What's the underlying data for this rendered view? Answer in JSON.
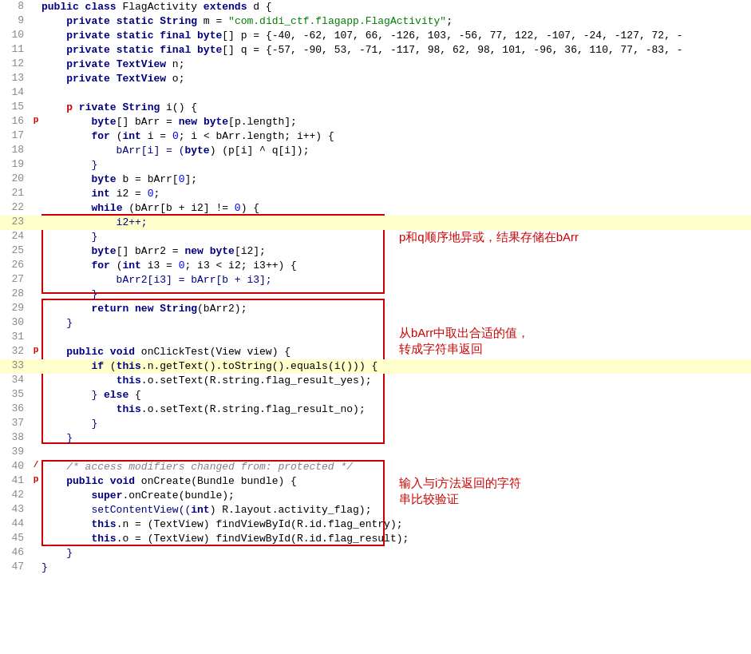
{
  "lines": [
    {
      "num": "8",
      "marker": "",
      "highlight": false,
      "tokens": [
        {
          "t": "public ",
          "c": "kw"
        },
        {
          "t": "class ",
          "c": "kw"
        },
        {
          "t": "FlagActivity ",
          "c": "plain"
        },
        {
          "t": "extends ",
          "c": "kw"
        },
        {
          "t": "d {",
          "c": "plain"
        }
      ]
    },
    {
      "num": "9",
      "marker": "",
      "highlight": false,
      "tokens": [
        {
          "t": "    "
        },
        {
          "t": "private ",
          "c": "kw"
        },
        {
          "t": "static ",
          "c": "kw"
        },
        {
          "t": "String ",
          "c": "type"
        },
        {
          "t": "m = ",
          "c": "plain"
        },
        {
          "t": "\"com.didi_ctf.flagapp.FlagActivity\"",
          "c": "str"
        },
        {
          "t": ";",
          "c": "plain"
        }
      ]
    },
    {
      "num": "10",
      "marker": "",
      "highlight": false,
      "tokens": [
        {
          "t": "    "
        },
        {
          "t": "private ",
          "c": "kw"
        },
        {
          "t": "static ",
          "c": "kw"
        },
        {
          "t": "final ",
          "c": "kw"
        },
        {
          "t": "byte",
          "c": "type"
        },
        {
          "t": "[] p = {-40, -62, 107, 66, -126, 103, -56, 77, 122, -107, -24, -127, 72, -",
          "c": "plain"
        }
      ]
    },
    {
      "num": "11",
      "marker": "",
      "highlight": false,
      "tokens": [
        {
          "t": "    "
        },
        {
          "t": "private ",
          "c": "kw"
        },
        {
          "t": "static ",
          "c": "kw"
        },
        {
          "t": "final ",
          "c": "kw"
        },
        {
          "t": "byte",
          "c": "type"
        },
        {
          "t": "[] q = {-57, -90, 53, -71, -117, 98, 62, 98, 101, -96, 36, 110, 77, -83, -",
          "c": "plain"
        }
      ]
    },
    {
      "num": "12",
      "marker": "",
      "highlight": false,
      "tokens": [
        {
          "t": "    "
        },
        {
          "t": "private ",
          "c": "kw"
        },
        {
          "t": "TextView ",
          "c": "type"
        },
        {
          "t": "n;",
          "c": "plain"
        }
      ]
    },
    {
      "num": "13",
      "marker": "",
      "highlight": false,
      "tokens": [
        {
          "t": "    "
        },
        {
          "t": "private ",
          "c": "kw"
        },
        {
          "t": "TextView ",
          "c": "type"
        },
        {
          "t": "o;",
          "c": "plain"
        }
      ]
    },
    {
      "num": "14",
      "marker": "",
      "highlight": false,
      "tokens": [
        {
          "t": ""
        }
      ]
    },
    {
      "num": "15",
      "marker": "",
      "highlight": false,
      "tokens": [
        {
          "t": "    "
        },
        {
          "t": "p",
          "c": "kw2"
        },
        {
          "t": " ",
          "c": "plain"
        },
        {
          "t": "rivate String ",
          "c": "kw"
        },
        {
          "t": "i() {",
          "c": "plain"
        }
      ]
    },
    {
      "num": "16",
      "marker": "p",
      "highlight": false,
      "tokens": [
        {
          "t": "        "
        },
        {
          "t": "byte",
          "c": "type"
        },
        {
          "t": "[] bArr = ",
          "c": "plain"
        },
        {
          "t": "new ",
          "c": "kw"
        },
        {
          "t": "byte",
          "c": "type"
        },
        {
          "t": "[p.length];",
          "c": "plain"
        }
      ]
    },
    {
      "num": "17",
      "marker": "",
      "highlight": false,
      "tokens": [
        {
          "t": "        "
        },
        {
          "t": "for ",
          "c": "kw"
        },
        {
          "t": "(",
          "c": "plain"
        },
        {
          "t": "int ",
          "c": "type"
        },
        {
          "t": "i = ",
          "c": "plain"
        },
        {
          "t": "0",
          "c": "num"
        },
        {
          "t": "; i < bArr.length; i++) {",
          "c": "plain"
        }
      ]
    },
    {
      "num": "18",
      "marker": "",
      "highlight": false,
      "tokens": [
        {
          "t": "            bArr[i] = ("
        },
        {
          "t": "byte",
          "c": "type"
        },
        {
          "t": ") (p[i] ^ q[i]);",
          "c": "plain"
        }
      ]
    },
    {
      "num": "19",
      "marker": "",
      "highlight": false,
      "tokens": [
        {
          "t": "        }"
        }
      ]
    },
    {
      "num": "20",
      "marker": "",
      "highlight": false,
      "tokens": [
        {
          "t": "        "
        },
        {
          "t": "byte",
          "c": "type"
        },
        {
          "t": " b = bArr[",
          "c": "plain"
        },
        {
          "t": "0",
          "c": "num"
        },
        {
          "t": "];",
          "c": "plain"
        }
      ]
    },
    {
      "num": "21",
      "marker": "",
      "highlight": false,
      "tokens": [
        {
          "t": "        "
        },
        {
          "t": "int ",
          "c": "type"
        },
        {
          "t": "i2 = ",
          "c": "plain"
        },
        {
          "t": "0",
          "c": "num"
        },
        {
          "t": ";",
          "c": "plain"
        }
      ]
    },
    {
      "num": "22",
      "marker": "",
      "highlight": false,
      "tokens": [
        {
          "t": "        "
        },
        {
          "t": "while ",
          "c": "kw"
        },
        {
          "t": "(bArr[b + i2] != ",
          "c": "plain"
        },
        {
          "t": "0",
          "c": "num"
        },
        {
          "t": ") {",
          "c": "plain"
        }
      ]
    },
    {
      "num": "23",
      "marker": "",
      "highlight": true,
      "tokens": [
        {
          "t": "            i2++;"
        }
      ]
    },
    {
      "num": "24",
      "marker": "",
      "highlight": false,
      "tokens": [
        {
          "t": "        }"
        }
      ]
    },
    {
      "num": "25",
      "marker": "",
      "highlight": false,
      "tokens": [
        {
          "t": "        "
        },
        {
          "t": "byte",
          "c": "type"
        },
        {
          "t": "[] bArr2 = ",
          "c": "plain"
        },
        {
          "t": "new ",
          "c": "kw"
        },
        {
          "t": "byte",
          "c": "type"
        },
        {
          "t": "[i2];",
          "c": "plain"
        }
      ]
    },
    {
      "num": "26",
      "marker": "",
      "highlight": false,
      "tokens": [
        {
          "t": "        "
        },
        {
          "t": "for ",
          "c": "kw"
        },
        {
          "t": "(",
          "c": "plain"
        },
        {
          "t": "int ",
          "c": "type"
        },
        {
          "t": "i3 = ",
          "c": "plain"
        },
        {
          "t": "0",
          "c": "num"
        },
        {
          "t": "; i3 < i2; i3++) {",
          "c": "plain"
        }
      ]
    },
    {
      "num": "27",
      "marker": "",
      "highlight": false,
      "tokens": [
        {
          "t": "            bArr2[i3] = bArr[b + i3];"
        }
      ]
    },
    {
      "num": "28",
      "marker": "",
      "highlight": false,
      "tokens": [
        {
          "t": "        }"
        }
      ]
    },
    {
      "num": "29",
      "marker": "",
      "highlight": false,
      "tokens": [
        {
          "t": "        "
        },
        {
          "t": "return ",
          "c": "kw"
        },
        {
          "t": "new ",
          "c": "kw"
        },
        {
          "t": "String",
          "c": "type"
        },
        {
          "t": "(bArr2);",
          "c": "plain"
        }
      ]
    },
    {
      "num": "30",
      "marker": "",
      "highlight": false,
      "tokens": [
        {
          "t": "    }"
        }
      ]
    },
    {
      "num": "31",
      "marker": "",
      "highlight": false,
      "tokens": [
        {
          "t": ""
        }
      ]
    },
    {
      "num": "32",
      "marker": "p",
      "highlight": false,
      "tokens": [
        {
          "t": "    "
        },
        {
          "t": "public ",
          "c": "kw"
        },
        {
          "t": "void ",
          "c": "type"
        },
        {
          "t": "onClickTest(View view) {",
          "c": "plain"
        }
      ]
    },
    {
      "num": "33",
      "marker": "",
      "highlight": true,
      "tokens": [
        {
          "t": "        "
        },
        {
          "t": "if ",
          "c": "kw"
        },
        {
          "t": "(",
          "c": "plain"
        },
        {
          "t": "this",
          "c": "kw"
        },
        {
          "t": ".n.getText().toString().equals(i())) {",
          "c": "plain"
        }
      ]
    },
    {
      "num": "34",
      "marker": "",
      "highlight": false,
      "tokens": [
        {
          "t": "            "
        },
        {
          "t": "this",
          "c": "kw"
        },
        {
          "t": ".o.setText(R.string.flag_result_yes);",
          "c": "plain"
        }
      ]
    },
    {
      "num": "35",
      "marker": "",
      "highlight": false,
      "tokens": [
        {
          "t": "        } "
        },
        {
          "t": "else ",
          "c": "kw"
        },
        {
          "t": "{",
          "c": "plain"
        }
      ]
    },
    {
      "num": "36",
      "marker": "",
      "highlight": false,
      "tokens": [
        {
          "t": "            "
        },
        {
          "t": "this",
          "c": "kw"
        },
        {
          "t": ".o.setText(R.string.flag_result_no);",
          "c": "plain"
        }
      ]
    },
    {
      "num": "37",
      "marker": "",
      "highlight": false,
      "tokens": [
        {
          "t": "        }"
        }
      ]
    },
    {
      "num": "38",
      "marker": "",
      "highlight": false,
      "tokens": [
        {
          "t": "    }"
        }
      ]
    },
    {
      "num": "39",
      "marker": "",
      "highlight": false,
      "tokens": [
        {
          "t": ""
        }
      ]
    },
    {
      "num": "40",
      "marker": "/",
      "highlight": false,
      "tokens": [
        {
          "t": "    "
        },
        {
          "t": "/* access modifiers changed from: protected */",
          "c": "comment"
        }
      ]
    },
    {
      "num": "41",
      "marker": "p",
      "highlight": false,
      "tokens": [
        {
          "t": "    "
        },
        {
          "t": "public ",
          "c": "kw"
        },
        {
          "t": "void ",
          "c": "type"
        },
        {
          "t": "onCreate(Bundle bundle) {",
          "c": "plain"
        }
      ]
    },
    {
      "num": "42",
      "marker": "",
      "highlight": false,
      "tokens": [
        {
          "t": "        "
        },
        {
          "t": "super",
          "c": "kw"
        },
        {
          "t": ".onCreate(bundle);",
          "c": "plain"
        }
      ]
    },
    {
      "num": "43",
      "marker": "",
      "highlight": false,
      "tokens": [
        {
          "t": "        setContentView(("
        },
        {
          "t": "int",
          "c": "type"
        },
        {
          "t": ") R.layout.activity_flag);",
          "c": "plain"
        }
      ]
    },
    {
      "num": "44",
      "marker": "",
      "highlight": false,
      "tokens": [
        {
          "t": "        "
        },
        {
          "t": "this",
          "c": "kw"
        },
        {
          "t": ".n = (TextView) findViewById(R.id.flag_entry);",
          "c": "plain"
        }
      ]
    },
    {
      "num": "45",
      "marker": "",
      "highlight": false,
      "tokens": [
        {
          "t": "        "
        },
        {
          "t": "this",
          "c": "kw"
        },
        {
          "t": ".o = (TextView) findViewById(R.id.flag_result);",
          "c": "plain"
        }
      ]
    },
    {
      "num": "46",
      "marker": "",
      "highlight": false,
      "tokens": [
        {
          "t": "    }"
        }
      ]
    },
    {
      "num": "47",
      "marker": "",
      "highlight": false,
      "tokens": [
        {
          "t": "}"
        }
      ]
    }
  ],
  "annotations": [
    {
      "id": "ann1",
      "text": "p和q顺序地异或，结果存储在bArr"
    },
    {
      "id": "ann2a",
      "text": "从bArr中取出合适的值，"
    },
    {
      "id": "ann2b",
      "text": "转成字符串返回"
    },
    {
      "id": "ann3a",
      "text": "输入与i方法返回的字符"
    },
    {
      "id": "ann3b",
      "text": "串比较验证"
    }
  ]
}
